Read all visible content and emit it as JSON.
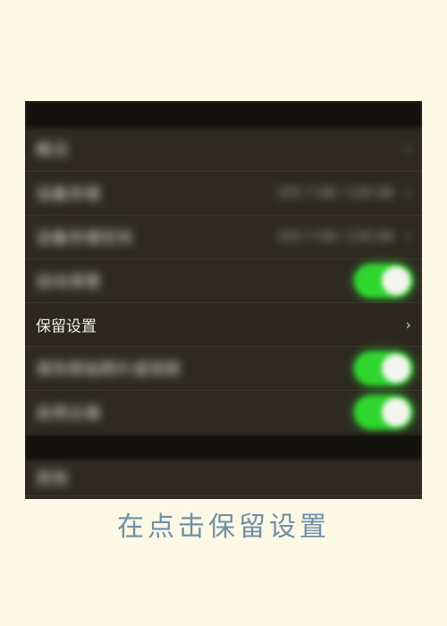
{
  "settings": {
    "rows": [
      {
        "label": "概况",
        "value": "",
        "has_chevron": true,
        "toggle": false,
        "blurred": true
      },
      {
        "label": "设备存储",
        "value": "105.7 GB / 128 GB",
        "has_chevron": true,
        "toggle": false,
        "blurred": true
      },
      {
        "label": "设备存储空间",
        "value": "105.7 GB / 128 GB",
        "has_chevron": true,
        "toggle": false,
        "blurred": true
      },
      {
        "label": "自动清理",
        "value": "",
        "has_chevron": false,
        "toggle": true,
        "blurred": true
      },
      {
        "label": "保留设置",
        "value": "",
        "has_chevron": true,
        "toggle": false,
        "blurred": false
      },
      {
        "label": "保存原始照片或视频",
        "value": "",
        "has_chevron": false,
        "toggle": true,
        "blurred": true
      },
      {
        "label": "启用云端",
        "value": "",
        "has_chevron": false,
        "toggle": true,
        "blurred": true
      }
    ],
    "bottom_row_label": "其他",
    "chevron_glyph": "›"
  },
  "colors": {
    "page_background": "#fbf8e6",
    "panel_background": "#2e2a22",
    "toggle_on": "#2ed62e",
    "caption": "#6f8fa6"
  },
  "caption": "在点击保留设置"
}
